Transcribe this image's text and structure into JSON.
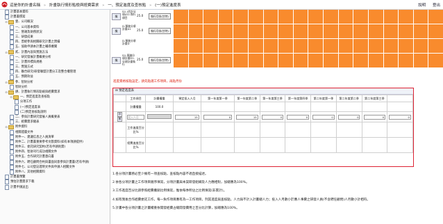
{
  "header": {
    "site_name": "這是你的計畫名稱",
    "breadcrumb": [
      "計畫執行情形點檢與經費需求",
      "一、預定進度及查核點",
      "(一)預定進度表"
    ],
    "links": [
      "說明",
      "登出"
    ]
  },
  "sidebar": [
    {
      "label": "計畫基本資料",
      "indent": 1,
      "icon": "page"
    },
    {
      "label": "計畫書撰寫",
      "indent": 1,
      "icon": "page"
    },
    {
      "label": "壹、公司概況",
      "indent": 1,
      "icon": "folder",
      "exp": "⊟"
    },
    {
      "label": "一、公司基本資料",
      "indent": 2,
      "icon": "page"
    },
    {
      "label": "二、營運及財務狀況",
      "indent": 2,
      "icon": "page"
    },
    {
      "label": "三、研發成果",
      "indent": 2,
      "icon": "page"
    },
    {
      "label": "四、曾經參與相關研究計畫之實績",
      "indent": 2,
      "icon": "page"
    },
    {
      "label": "五、協助申請本計畫之輔導機關",
      "indent": 2,
      "icon": "page"
    },
    {
      "label": "貳、計畫內容與實施方法",
      "indent": 1,
      "icon": "folder",
      "exp": "⊟"
    },
    {
      "label": "一、研究發展計畫概要分析",
      "indent": 2,
      "icon": "page"
    },
    {
      "label": "二、計畫目標與規格",
      "indent": 2,
      "icon": "page"
    },
    {
      "label": "三、實施方式",
      "indent": 2,
      "icon": "page"
    },
    {
      "label": "四、聯合研究/研發聯盟計畫分工及整合權管理",
      "indent": 2,
      "icon": "page"
    },
    {
      "label": "五、預期效益",
      "indent": 2,
      "icon": "page"
    },
    {
      "label": "參、智財分析",
      "indent": 1,
      "icon": "folder",
      "exp": "⊟"
    },
    {
      "label": "智財分析",
      "indent": 2,
      "icon": "page"
    },
    {
      "label": "肆、計畫執行情形點檢與經費需求",
      "indent": 1,
      "icon": "folder",
      "exp": "⊟"
    },
    {
      "label": "一、預定進度及查核點",
      "indent": 2,
      "icon": "folder",
      "exp": "⊟"
    },
    {
      "label": "分項工作",
      "indent": 3,
      "icon": "page"
    },
    {
      "label": "(一)預定進度表",
      "indent": 3,
      "icon": "page"
    },
    {
      "label": "(二)預定查核點說明",
      "indent": 3,
      "icon": "page"
    },
    {
      "label": "二、參與計畫研究發展人員概要表",
      "indent": 2,
      "icon": "page"
    },
    {
      "label": "三、經費需求總表",
      "indent": 2,
      "icon": "page"
    },
    {
      "label": "附件資料",
      "indent": 1,
      "icon": "folder",
      "exp": "⊟"
    },
    {
      "label": "相關證書文件",
      "indent": 2,
      "icon": "page"
    },
    {
      "label": "附件一、建議信息之人員清單",
      "indent": 2,
      "icon": "page"
    },
    {
      "label": "附件二、計畫書重要參考文獻資料(如有本項請提供)",
      "indent": 2,
      "icon": "page"
    },
    {
      "label": "附件三、委託研究契約(若有申請則需)",
      "indent": 2,
      "icon": "page"
    },
    {
      "label": "附件四、智財刊行成功相關文件",
      "indent": 2,
      "icon": "page"
    },
    {
      "label": "附件五、合作研究計畫意向書",
      "indent": 2,
      "icon": "page"
    },
    {
      "label": "附件六、聘任顧問合約與書面同意參與計畫書(若有申請)",
      "indent": 2,
      "icon": "page"
    },
    {
      "label": "附件七、公司登記證明文件與申請人相關文件",
      "indent": 2,
      "icon": "page"
    },
    {
      "label": "附件八、其他相關資料",
      "indent": 2,
      "icon": "page"
    },
    {
      "label": "計畫書預覽",
      "indent": 1,
      "icon": "page"
    },
    {
      "label": "預估計畫需求下載",
      "indent": 1,
      "icon": "page"
    },
    {
      "label": "計畫申請送出",
      "indent": 1,
      "icon": "page"
    }
  ],
  "grid_rows": [
    {
      "btn": "檢",
      "label": "D1-(估計分項)D2-執行項目",
      "value": "25.0",
      "action": "執行月份(甘特)"
    },
    {
      "btn": "檢",
      "label": "D-預進分項計畫A1",
      "value": "25.0",
      "action": "執行月份(甘特)"
    },
    {
      "btn": "",
      "label": "D-預進分項計畫D",
      "value": "",
      "action": ""
    },
    {
      "btn": "檢",
      "label": "D1-預進分項計畫D1-分項計畫執行",
      "value": "25.0",
      "action": "執行月份(甘特)"
    }
  ],
  "warning_text": "進度資格核點設定，請先點選工作項目，再點月份",
  "panel": {
    "title": "預定進度表",
    "headers": [
      "工作項目",
      "計畫權重",
      "預定投入人月",
      "第一年度第一季",
      "第一年度第二季",
      "第一年度第三季",
      "第一年度第四季",
      "第二年度第一季",
      "第二年度第二季",
      "第二年度第三季"
    ],
    "weight_row": {
      "label": "計畫權重",
      "value": "100.0"
    },
    "input_row": {
      "tags": [
        "存",
        "刪"
      ],
      "placeholder": "投入人月",
      "values": [
        "15",
        "0",
        "15",
        "0",
        "0",
        "0",
        "0",
        "0",
        "0"
      ]
    },
    "row_a": {
      "label": "工作進度百分比%"
    },
    "row_b": {
      "label": "經費進度百分比%"
    }
  },
  "notes": [
    "1.各分項計畫務必至少擁有一項查核點，查核點內容不適直接描述。",
    "2.依各分項計畫之工作項目順序填寫，分項計畫與本案研發組織及人力應相對，加總應為100%。",
    "3.工作進度百分比請參照經費攤銷比例填寫，惟依每季所佔之比例填寫(非累計)。",
    "4.如有我後合作經費委託工作，每一負作項目應有為一工作項目，列其進度與查核點，人力與不計入計畫總人力；投入人月數小於應人事費之研發人員(不含聘任顧問)人月數小計相符。",
    "5.計畫中各分項計畫之計畫權重依開發經費占總開發費用之百分比計算，加總應為100%。"
  ],
  "colors": {
    "orange": "#f98b2d",
    "panel_border": "#d22233",
    "warning": "#d21111"
  }
}
